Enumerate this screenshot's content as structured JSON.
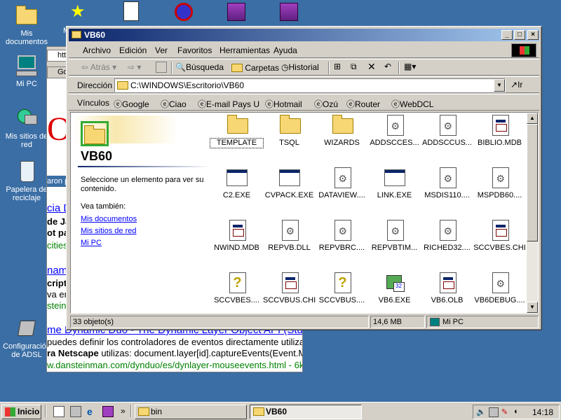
{
  "desktop": {
    "icons": [
      {
        "label": "Mis documentos"
      },
      {
        "label": "Mi PC"
      },
      {
        "label": "Mis sitios de red"
      },
      {
        "label": "Papelera de reciclaje"
      },
      {
        "label": "Configuración de ADSL"
      }
    ],
    "partial_label": "M"
  },
  "background_browser": {
    "lines": [
      "htt",
      "Go",
      "aron p",
      "cia D",
      "de Ja",
      "ot par",
      "cities",
      "namic",
      "cript",
      "va en",
      "steinn",
      "me Dynamic Duo - The Dynamic Layer Object API (Stu",
      "puedes definir los controladores de eventos directamente utiliza",
      "ra Netscape",
      " utilizas: document.layer[id].captureEvents(Event.M",
      "w.dansteinman.com/dynduo/es/dynlayer-mouseevents.html - 6k"
    ]
  },
  "window": {
    "title": "VB60",
    "controls": {
      "minimize": "_",
      "maximize": "□",
      "close": "×"
    },
    "menu": [
      "Archivo",
      "Edición",
      "Ver",
      "Favoritos",
      "Herramientas",
      "Ayuda"
    ],
    "toolbar": {
      "back": "Atrás",
      "search": "Búsqueda",
      "folders": "Carpetas",
      "history": "Historial"
    },
    "address": {
      "label": "Dirección",
      "value": "C:\\WINDOWS\\Escritorio\\VB60",
      "go": "Ir"
    },
    "links": {
      "label": "Vínculos",
      "items": [
        "Google",
        "Ciao",
        "E-mail Pays U",
        "Hotmail",
        "Ozú",
        "Router",
        "WebDCL"
      ]
    },
    "left_pane": {
      "title": "VB60",
      "prompt": "Seleccione un elemento para ver su contenido.",
      "see_also": "Vea también:",
      "links": [
        "Mis documentos",
        "Mis sitios de red",
        "Mi PC"
      ]
    },
    "files": [
      {
        "name": "TEMPLATE",
        "icon": "folder-icon",
        "selected": true
      },
      {
        "name": "TSQL",
        "icon": "folder-icon"
      },
      {
        "name": "WIZARDS",
        "icon": "folder-icon"
      },
      {
        "name": "ADDSCCES...",
        "icon": "dll-icon"
      },
      {
        "name": "ADDSCCUS...",
        "icon": "dll-icon"
      },
      {
        "name": "BIBLIO.MDB",
        "icon": "mdb-icon"
      },
      {
        "name": "C2.EXE",
        "icon": "exe-icon"
      },
      {
        "name": "CVPACK.EXE",
        "icon": "exe-icon"
      },
      {
        "name": "DATAVIEW....",
        "icon": "dll-icon"
      },
      {
        "name": "LINK.EXE",
        "icon": "exe-icon"
      },
      {
        "name": "MSDIS110....",
        "icon": "dll-icon"
      },
      {
        "name": "MSPDB60....",
        "icon": "dll-icon"
      },
      {
        "name": "NWIND.MDB",
        "icon": "mdb-icon"
      },
      {
        "name": "REPVB.DLL",
        "icon": "dll-icon"
      },
      {
        "name": "REPVBRC....",
        "icon": "dll-icon"
      },
      {
        "name": "REPVBTIM...",
        "icon": "dll-icon"
      },
      {
        "name": "RICHED32....",
        "icon": "dll-icon"
      },
      {
        "name": "SCCVBES.CHI",
        "icon": "mdb-icon"
      },
      {
        "name": "SCCVBES....",
        "icon": "help-icon"
      },
      {
        "name": "SCCVBUS.CHI",
        "icon": "mdb-icon"
      },
      {
        "name": "SCCVBUS....",
        "icon": "help-icon"
      },
      {
        "name": "VB6.EXE",
        "icon": "vb-icon"
      },
      {
        "name": "VB6.OLB",
        "icon": "mdb-icon"
      },
      {
        "name": "VB6DEBUG....",
        "icon": "dll-icon"
      }
    ],
    "status": {
      "count": "33 objeto(s)",
      "size": "14,6 MB",
      "location": "Mi PC"
    }
  },
  "taskbar": {
    "start": "Inicio",
    "chevron": "»",
    "tasks": [
      {
        "label": "bin",
        "active": false
      },
      {
        "label": "VB60",
        "active": true
      }
    ],
    "clock": "14:18"
  },
  "colors": {
    "desktop": "#3a6ea5",
    "titlebar_start": "#0a246a",
    "titlebar_end": "#a6caf0",
    "chrome": "#d4d0c8"
  }
}
